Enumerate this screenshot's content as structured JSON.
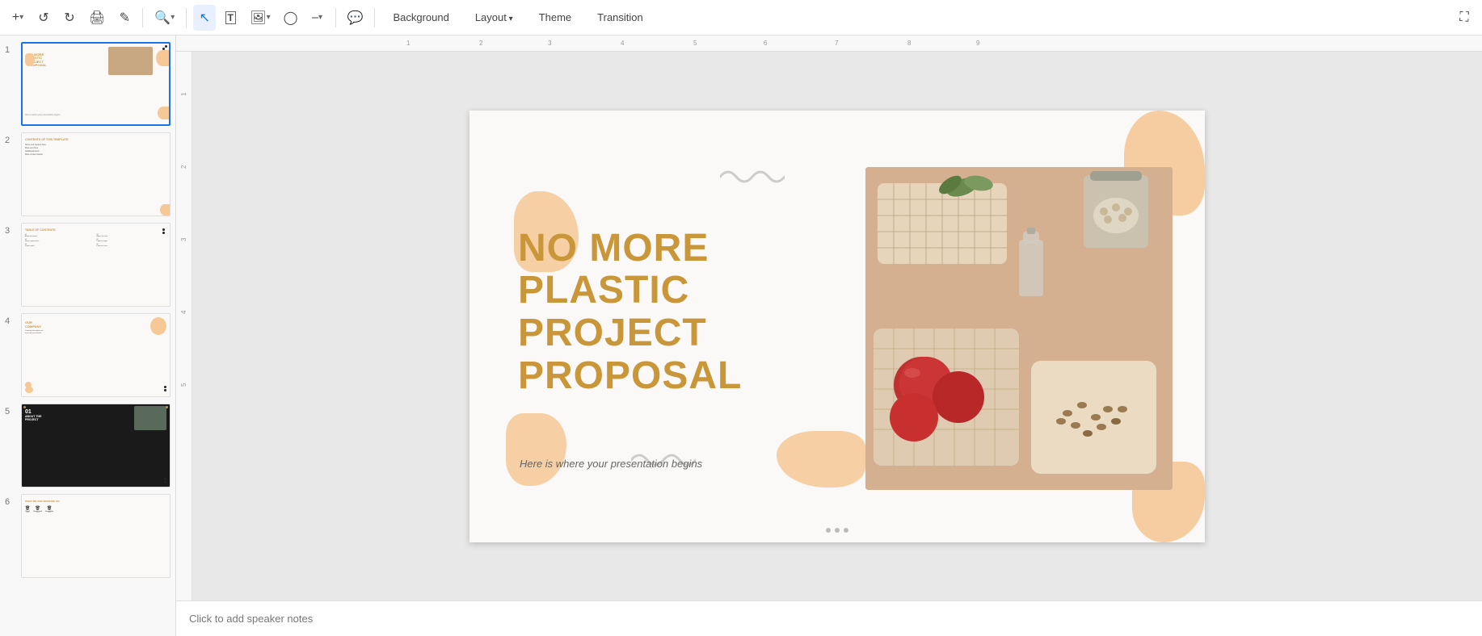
{
  "toolbar": {
    "buttons": [
      {
        "name": "add",
        "icon": "+",
        "label": "New"
      },
      {
        "name": "undo",
        "icon": "↩",
        "label": "Undo"
      },
      {
        "name": "redo",
        "icon": "↪",
        "label": "Redo"
      },
      {
        "name": "print",
        "icon": "🖨",
        "label": "Print"
      },
      {
        "name": "paint-format",
        "icon": "🎨",
        "label": "Paint format"
      },
      {
        "name": "zoom",
        "icon": "⊕",
        "label": "Zoom"
      },
      {
        "name": "cursor",
        "icon": "↖",
        "label": "Select"
      },
      {
        "name": "text-box",
        "icon": "T",
        "label": "Text box"
      },
      {
        "name": "image",
        "icon": "🖼",
        "label": "Image"
      },
      {
        "name": "shape",
        "icon": "○",
        "label": "Shape"
      },
      {
        "name": "line",
        "icon": "╱",
        "label": "Line"
      },
      {
        "name": "comment",
        "icon": "💬",
        "label": "Comment"
      }
    ],
    "format_buttons": [
      {
        "name": "background",
        "label": "Background",
        "has_arrow": false
      },
      {
        "name": "layout",
        "label": "Layout",
        "has_arrow": true
      },
      {
        "name": "theme",
        "label": "Theme",
        "has_arrow": false
      },
      {
        "name": "transition",
        "label": "Transition",
        "has_arrow": false
      }
    ]
  },
  "slides": [
    {
      "number": "1",
      "selected": true,
      "title": "NO MORE\nPLASTIC\nPROJECT\nPROPOSAL"
    },
    {
      "number": "2",
      "selected": false,
      "title": "CONTENTS OF THIS TEMPLATE"
    },
    {
      "number": "3",
      "selected": false,
      "title": "TABLE OF CONTENTS"
    },
    {
      "number": "4",
      "selected": false,
      "title": "OUR COMPANY"
    },
    {
      "number": "5",
      "selected": false,
      "title": "01\nABOUT THE\nPROJECT"
    },
    {
      "number": "6",
      "selected": false,
      "title": "WHAT WE ARE WORKING ON"
    }
  ],
  "slide": {
    "title_line1": "NO MORE",
    "title_line2": "PLASTIC",
    "title_line3": "PROJECT",
    "title_line4": "PROPOSAL",
    "subtitle": "Here is where your presentation begins"
  },
  "notes": {
    "placeholder": "Click to add speaker notes"
  }
}
